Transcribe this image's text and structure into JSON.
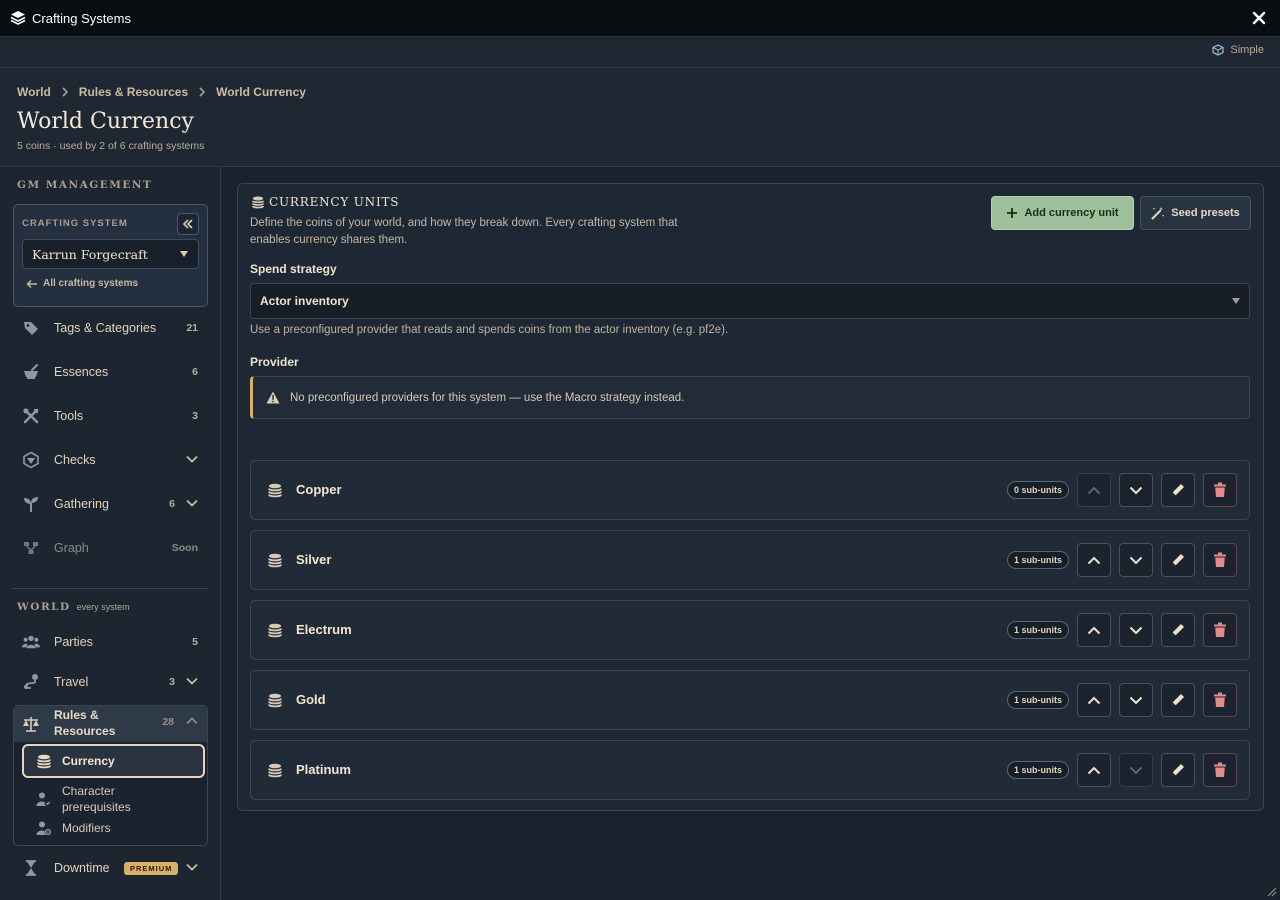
{
  "window": {
    "title": "Crafting Systems"
  },
  "mode": {
    "label": "Simple"
  },
  "breadcrumb": [
    "World",
    "Rules & Resources",
    "World Currency"
  ],
  "page": {
    "title": "World Currency",
    "subtitle": "5 coins · used by 2 of 6 crafting systems"
  },
  "sidebar": {
    "gm_label": "GM MANAGEMENT",
    "crafting_system": {
      "label": "CRAFTING SYSTEM",
      "selected": "Karrun Forgecraft",
      "all_link": "All crafting systems"
    },
    "gm_items": [
      {
        "label": "Tags & Categories",
        "count": "21",
        "icon": "tag-icon"
      },
      {
        "label": "Essences",
        "count": "6",
        "icon": "mortar-icon"
      },
      {
        "label": "Tools",
        "count": "3",
        "icon": "tools-icon"
      },
      {
        "label": "Checks",
        "count": "",
        "icon": "dice-icon"
      },
      {
        "label": "Gathering",
        "count": "6",
        "icon": "sprout-icon"
      },
      {
        "label": "Graph",
        "count": "Soon",
        "icon": "graph-icon"
      }
    ],
    "world_label": "WORLD",
    "world_sub": "every system",
    "world_items": [
      {
        "label": "Parties",
        "count": "5",
        "icon": "users-icon"
      },
      {
        "label": "Travel",
        "count": "3",
        "icon": "route-icon"
      }
    ],
    "rules_group": {
      "label": "Rules & Resources",
      "count": "28",
      "children": [
        {
          "label": "Currency",
          "icon": "coins-icon"
        },
        {
          "label": "Character prerequisites",
          "icon": "user-check-icon"
        },
        {
          "label": "Modifiers",
          "icon": "user-gear-icon"
        }
      ]
    },
    "downtime": {
      "label": "Downtime",
      "badge": "PREMIUM"
    }
  },
  "panel": {
    "title": "CURRENCY UNITS",
    "description": "Define the coins of your world, and how they break down. Every crafting system that enables currency shares them.",
    "add_button": "Add currency unit",
    "seed_button": "Seed presets",
    "spend_label": "Spend strategy",
    "spend_value": "Actor inventory",
    "spend_help": "Use a preconfigured provider that reads and spends coins from the actor inventory (e.g. pf2e).",
    "provider_label": "Provider",
    "provider_warning": "No preconfigured providers for this system — use the Macro strategy instead."
  },
  "currencies": [
    {
      "name": "Copper",
      "badge": "0 sub-units",
      "up_enabled": false,
      "down_enabled": true
    },
    {
      "name": "Silver",
      "badge": "1 sub-units",
      "up_enabled": true,
      "down_enabled": true
    },
    {
      "name": "Electrum",
      "badge": "1 sub-units",
      "up_enabled": true,
      "down_enabled": true
    },
    {
      "name": "Gold",
      "badge": "1 sub-units",
      "up_enabled": true,
      "down_enabled": true
    },
    {
      "name": "Platinum",
      "badge": "1 sub-units",
      "up_enabled": true,
      "down_enabled": false
    }
  ],
  "colors": {
    "accent": "#9ec09a",
    "premium": "#d8b066",
    "delete": "#e58a8a",
    "text": "#e8d9c4"
  }
}
